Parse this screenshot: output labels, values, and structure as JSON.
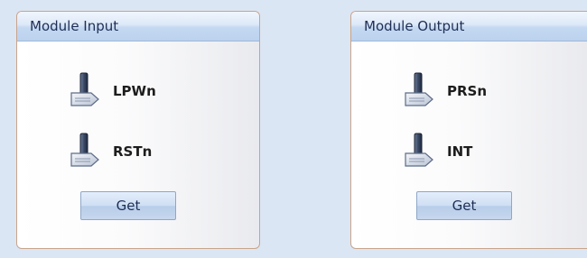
{
  "input_panel": {
    "title": "Module Input",
    "signals": [
      {
        "label": "LPWn",
        "icon": "toggle-switch-icon"
      },
      {
        "label": "RSTn",
        "icon": "toggle-switch-icon"
      }
    ],
    "get_label": "Get"
  },
  "output_panel": {
    "title": "Module Output",
    "signals": [
      {
        "label": "PRSn",
        "icon": "toggle-switch-icon"
      },
      {
        "label": "INT",
        "icon": "toggle-switch-icon"
      }
    ],
    "get_label": "Get"
  }
}
